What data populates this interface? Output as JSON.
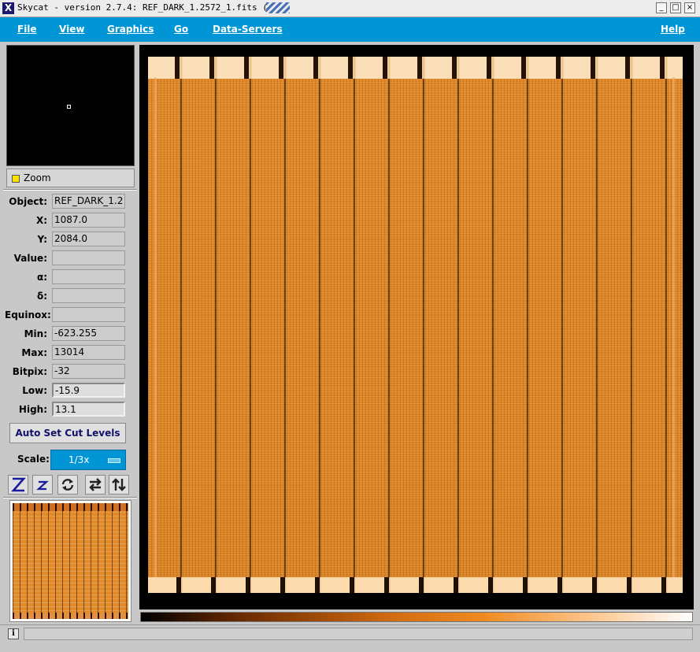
{
  "window": {
    "app_icon": "X",
    "title": "Skycat - version 2.7.4: REF_DARK_1.2572_1.fits (1)",
    "buttons": [
      "_",
      "□",
      "×"
    ]
  },
  "menubar": {
    "items": [
      "File",
      "View",
      "Graphics",
      "Go",
      "Data-Servers"
    ],
    "help": "Help"
  },
  "zoom": {
    "label": "Zoom"
  },
  "info": {
    "object": {
      "label": "Object:",
      "value": "REF_DARK_1.2"
    },
    "x": {
      "label": "X:",
      "value": "1087.0"
    },
    "y": {
      "label": "Y:",
      "value": "2084.0"
    },
    "pixel_value": {
      "label": "Value:",
      "value": ""
    },
    "alpha": {
      "label": "α:",
      "value": ""
    },
    "delta": {
      "label": "δ:",
      "value": ""
    },
    "equinox": {
      "label": "Equinox:",
      "value": ""
    },
    "min": {
      "label": "Min:",
      "value": "-623.255"
    },
    "max": {
      "label": "Max:",
      "value": "13014"
    },
    "bitpix": {
      "label": "Bitpix:",
      "value": "-32"
    },
    "low": {
      "label": "Low:",
      "value": "-15.9"
    },
    "high": {
      "label": "High:",
      "value": "13.1"
    }
  },
  "controls": {
    "auto_cut": "Auto Set Cut Levels",
    "scale_label": "Scale:",
    "scale_value": "1/3x"
  },
  "toolbar_icons": [
    "zoom-in-icon",
    "zoom-out-icon",
    "rotate-icon",
    "flip-x-icon",
    "flip-y-icon"
  ],
  "colors": {
    "menubar": "#0096d6",
    "image_orange": "#e08828"
  },
  "statusbar": {
    "icon": "i",
    "message": ""
  }
}
